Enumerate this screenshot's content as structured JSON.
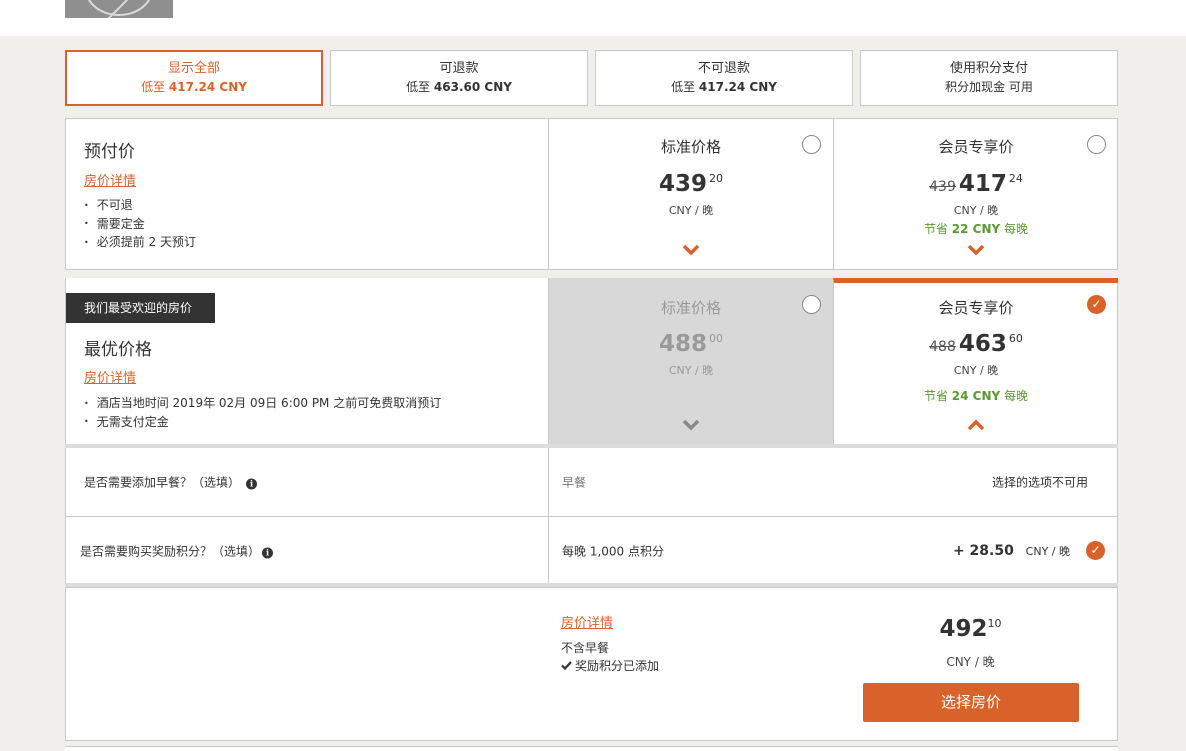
{
  "filters": [
    {
      "title": "显示全部",
      "sub_prefix": "低至",
      "sub_value": "417.24 CNY",
      "active": true
    },
    {
      "title": "可退款",
      "sub_prefix": "低至",
      "sub_value": "463.60 CNY",
      "active": false
    },
    {
      "title": "不可退款",
      "sub_prefix": "低至",
      "sub_value": "417.24 CNY",
      "active": false
    },
    {
      "title": "使用积分支付",
      "sub_prefix": "积分加现金 可用",
      "sub_value": "",
      "active": false
    }
  ],
  "rates": [
    {
      "title": "预付价",
      "detail_link": "房价详情",
      "bullets": [
        "不可退",
        "需要定金",
        "必须提前 2 天预订"
      ],
      "standard": {
        "label": "标准价格",
        "price": "439",
        "decimal": "20",
        "unit": "CNY / 晚"
      },
      "member": {
        "label": "会员专享价",
        "old_price": "439",
        "price": "417",
        "decimal": "24",
        "unit": "CNY / 晚",
        "save_prefix": "节省",
        "save_value": "22 CNY",
        "save_suffix": "每晚"
      }
    },
    {
      "badge": "我们最受欢迎的房价",
      "title": "最优价格",
      "detail_link": "房价详情",
      "bullets": [
        "酒店当地时间 2019年 02月 09日 6:00 PM 之前可免费取消预订",
        "无需支付定金"
      ],
      "standard": {
        "label": "标准价格",
        "price": "488",
        "decimal": "00",
        "unit": "CNY / 晚"
      },
      "member": {
        "label": "会员专享价",
        "old_price": "488",
        "price": "463",
        "decimal": "60",
        "unit": "CNY / 晚",
        "save_prefix": "节省",
        "save_value": "24 CNY",
        "save_suffix": "每晚"
      }
    }
  ],
  "options": {
    "breakfast": {
      "question": "是否需要添加早餐？（选填）",
      "label": "早餐",
      "status": "选择的选项不可用"
    },
    "points": {
      "question": "是否需要购买奖励积分？（选填）",
      "label": "每晚 1,000 点积分",
      "price": "+ 28.50",
      "unit": "CNY / 晚"
    }
  },
  "summary": {
    "detail_link": "房价详情",
    "line1": "不含早餐",
    "line2": "奖励积分已添加",
    "total": "492",
    "total_decimal": "10",
    "unit": "CNY / 晚",
    "button": "选择房价"
  },
  "colors": {
    "accent": "#d9622b",
    "savings": "#5a9a32",
    "badge_bg": "#333333"
  },
  "icons": {
    "info": "info-icon",
    "check": "check-circle-icon",
    "radio": "radio-empty-icon",
    "chevron_down": "chevron-down-icon",
    "chevron_up": "chevron-up-icon",
    "checkmark": "checkmark-icon"
  }
}
